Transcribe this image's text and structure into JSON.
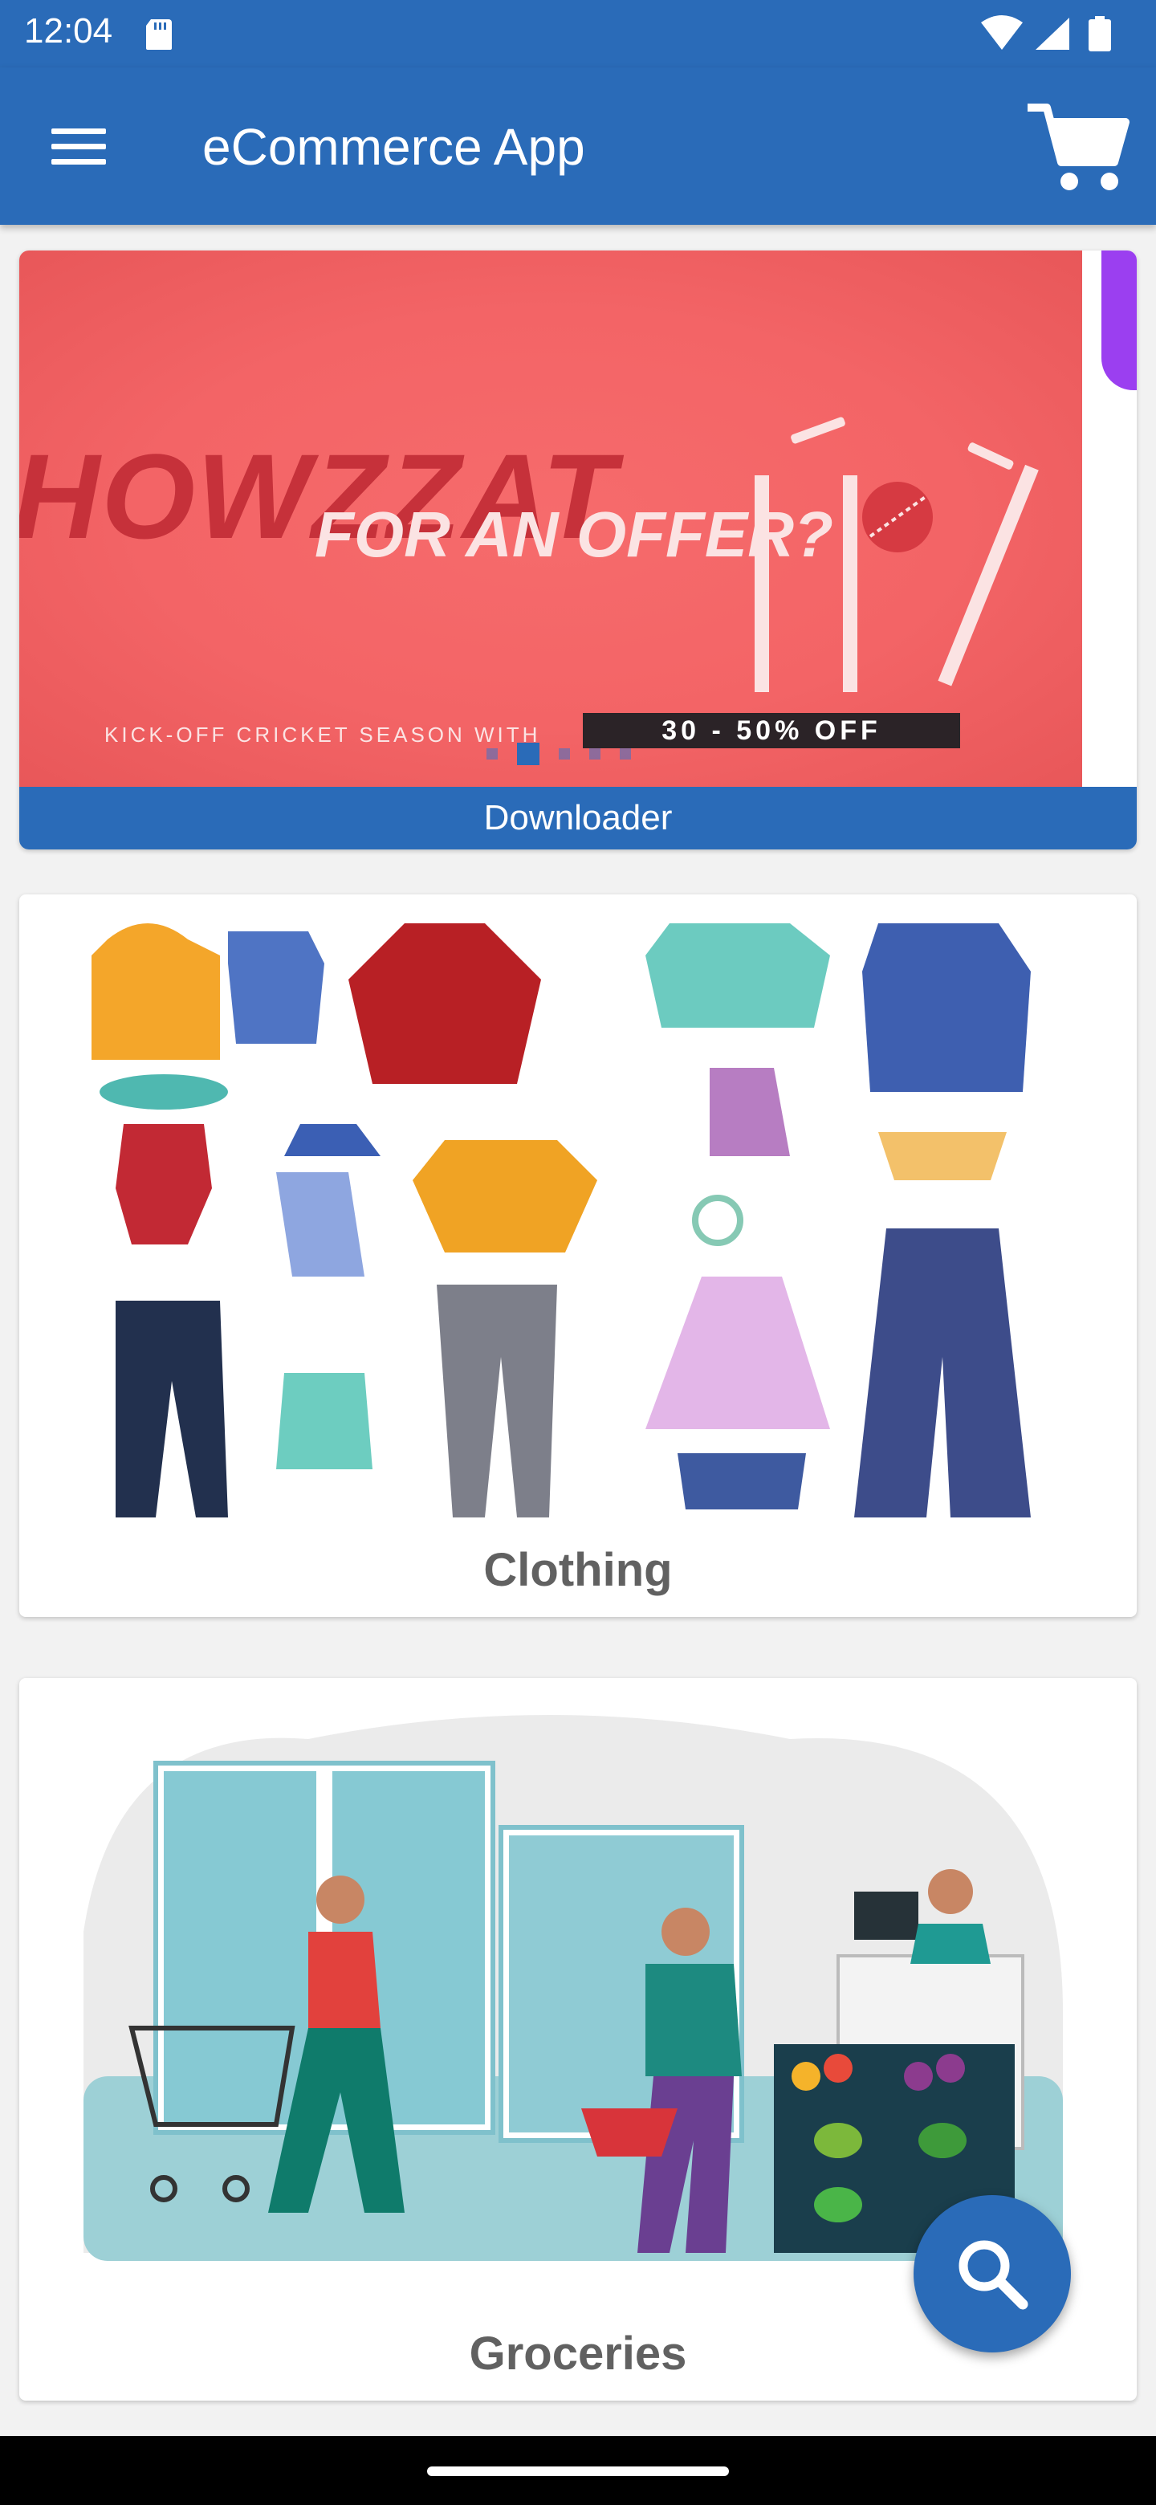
{
  "status_bar": {
    "time": "12:04",
    "icons": [
      "sd-card-icon",
      "wifi-icon",
      "signal-icon",
      "battery-icon"
    ]
  },
  "app_bar": {
    "title": "eCommerce App",
    "menu_icon": "menu-icon",
    "cart_icon": "cart-icon"
  },
  "banner": {
    "headline": "HOWZZAT",
    "subheadline": "FOR AN OFFER?",
    "tagline": "KICK-OFF CRICKET SEASON WITH",
    "discount": "30 - 50% OFF",
    "caption": "Downloader",
    "slide_count": 5,
    "active_slide": 2
  },
  "categories": [
    {
      "label": "Clothing"
    },
    {
      "label": "Groceries"
    }
  ],
  "fab": {
    "icon": "search-icon"
  },
  "colors": {
    "primary": "#2a6bb8",
    "banner_red": "#f36466",
    "label_gray": "#616161"
  }
}
